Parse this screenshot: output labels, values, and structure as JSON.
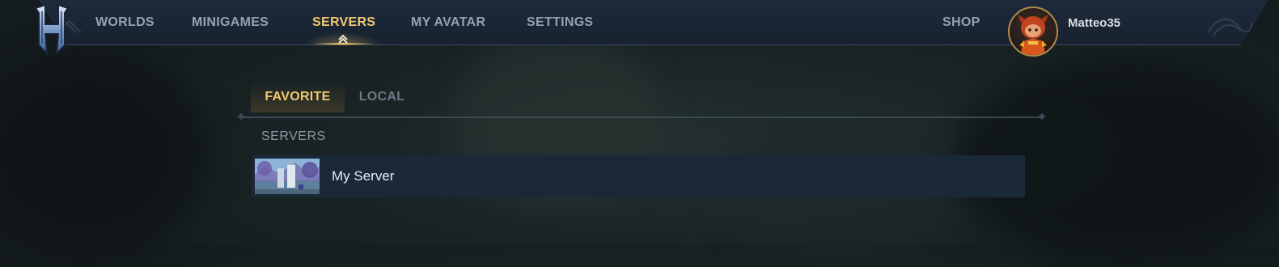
{
  "nav": {
    "items": [
      {
        "label": "WORLDS",
        "active": false
      },
      {
        "label": "MINIGAMES",
        "active": false
      },
      {
        "label": "SERVERS",
        "active": true
      },
      {
        "label": "MY AVATAR",
        "active": false
      },
      {
        "label": "SETTINGS",
        "active": false
      }
    ],
    "shop_label": "SHOP",
    "logo_icon": "game-logo-h-icon"
  },
  "user": {
    "name": "Matteo35",
    "avatar_icon": "avatar-character-icon"
  },
  "tabs": [
    {
      "label": "FAVORITE",
      "active": true
    },
    {
      "label": "LOCAL",
      "active": false
    }
  ],
  "section": {
    "heading": "SERVERS"
  },
  "servers": [
    {
      "name": "My Server",
      "thumbnail_icon": "server-thumbnail-image"
    }
  ],
  "colors": {
    "accent": "#f2c871",
    "nav_bg": "#1b2735",
    "row_bg": "#1b2838",
    "inactive_text": "#97a1ae"
  }
}
